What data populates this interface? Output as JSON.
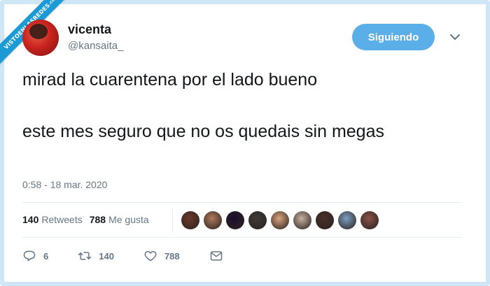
{
  "watermark": {
    "text": "VISTOENLASREDES",
    "suffix": ".com"
  },
  "tweet": {
    "author_name": "vicenta",
    "author_handle": "@kansaita_",
    "follow_label": "Siguiendo",
    "line1": "mirad la cuarentena por el lado bueno",
    "line2": "este mes seguro que no os quedais sin megas",
    "timestamp": "0:58 - 18 mar. 2020"
  },
  "stats": {
    "retweets_count": "140",
    "retweets_label": "Retweets",
    "likes_count": "788",
    "likes_label": "Me gusta"
  },
  "liker_avatar_colors": [
    "#6b3a2a",
    "#b07a5a",
    "#1a0f2e",
    "#3e3a36",
    "#d9a47e",
    "#c9b0a0",
    "#4a2f28",
    "#7c9fc2",
    "#8a5248"
  ],
  "actions": {
    "reply_count": "6",
    "retweet_count": "140",
    "like_count": "788"
  },
  "colors": {
    "accent": "#5aafe8",
    "text": "#14171a",
    "muted": "#657786",
    "frame": "#cfe6f7"
  }
}
